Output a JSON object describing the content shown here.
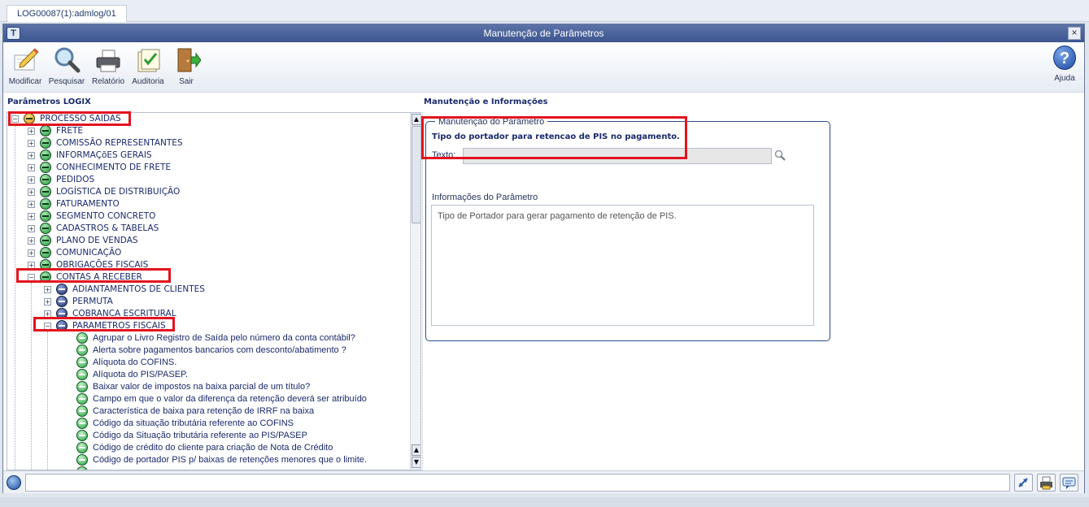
{
  "tab": {
    "label": "LOG00087(1):admlog/01"
  },
  "window": {
    "title": "Manutenção de Parâmetros",
    "close": "×"
  },
  "toolbar": {
    "modificar": "Modificar",
    "pesquisar": "Pesquisar",
    "relatorio": "Relatório",
    "auditoria": "Auditoria",
    "sair": "Sair",
    "ajuda": "Ajuda",
    "ajuda_glyph": "?"
  },
  "left_panel": {
    "title": "Parâmetros LOGIX"
  },
  "tree": {
    "root": "PROCESSO SAIDAS",
    "level1": [
      "FRETE",
      "COMISSÃO REPRESENTANTES",
      "INFORMAÇõES GERAIS",
      "CONHECIMENTO DE FRETE",
      "PEDIDOS",
      "LOGÍSTICA DE DISTRIBUIÇÃO",
      "FATURAMENTO",
      "SEGMENTO CONCRETO",
      "CADASTROS & TABELAS",
      "PLANO DE VENDAS",
      "COMUNICAÇÃO",
      "OBRIGAÇÕES FISCAIS"
    ],
    "expanded": "CONTAS A RECEBER",
    "level2": [
      "ADIANTAMENTOS DE CLIENTES",
      "PERMUTA",
      "COBRANCA ESCRITURAL"
    ],
    "expanded2": "PARAMETROS FISCAIS",
    "leaves": [
      "Agrupar o Livro Registro de Saída pelo número da conta contábil?",
      "Alerta sobre pagamentos bancarios com desconto/abatimento ?",
      "Alíquota do COFINS.",
      "Alíquota do PIS/PASEP.",
      "Baixar valor de impostos na baixa parcial de um título?",
      "Campo em que o valor da diferença da retenção deverá ser atribuído",
      "Característica de baixa para retenção de IRRF na baixa",
      "Código da situação tributária referente ao COFINS",
      "Código da Situação tributária referente ao PIS/PASEP",
      "Código de crédito do cliente para criação de Nota de Crédito",
      "Código de portador PIS p/ baixas de retenções menores que o limite."
    ]
  },
  "right_panel": {
    "title": "Manutenção e Informações",
    "group_legend": "Manutenção do Parâmetro",
    "param_desc": "Tipo do portador para retencao de PIS no pagamento.",
    "text_label": "Texto:",
    "text_value": "",
    "info_label": "Informações do Parâmetro",
    "info_text": "Tipo de Portador para gerar pagamento de retenção de PIS."
  },
  "status": {
    "text": ""
  },
  "colors": {
    "highlight": "#e2141f",
    "titlebar": "#3d5690"
  }
}
